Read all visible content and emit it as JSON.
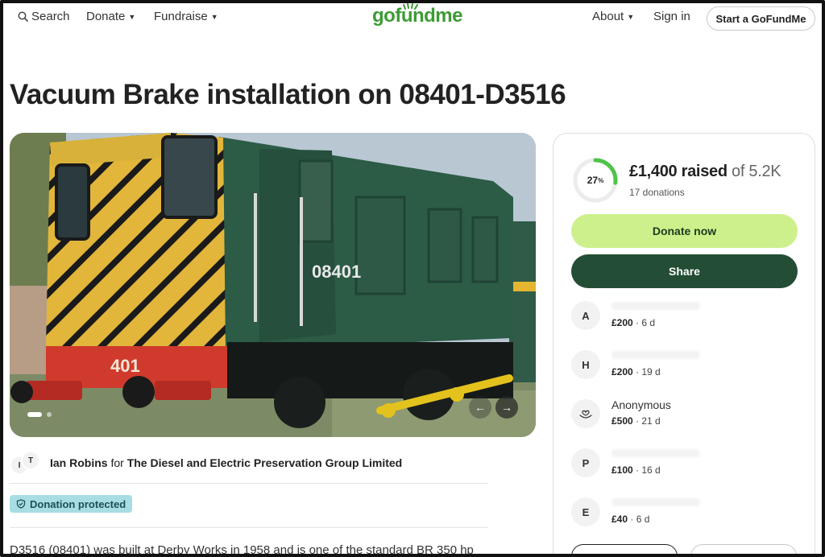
{
  "header": {
    "search_label": "Search",
    "donate_label": "Donate",
    "fundraise_label": "Fundraise",
    "logo_text": "gofundme",
    "about_label": "About",
    "signin_label": "Sign in",
    "start_label": "Start a GoFundMe"
  },
  "campaign": {
    "title": "Vacuum Brake installation on 08401-D3516",
    "hero_number_side": "08401",
    "hero_number_front": "401",
    "organizer_initials": [
      "I",
      "T"
    ],
    "organizer_name": "Ian Robins",
    "organizer_for": "for",
    "beneficiary": "The Diesel and Electric Preservation Group Limited",
    "protected_label": "Donation protected",
    "description_start": "D3516 (08401) was built at Derby Works in 1958 and is one of the standard BR 350 hp"
  },
  "sidebar": {
    "percent": "27",
    "percent_value": 0.27,
    "raised_amount": "£1,400 raised",
    "goal_text": "of 5.2K",
    "donation_count": "17 donations",
    "donate_now_label": "Donate now",
    "share_label": "Share",
    "donors": [
      {
        "initial": "A",
        "name": "",
        "amount": "£200",
        "age": "6 d"
      },
      {
        "initial": "H",
        "name": "",
        "amount": "£200",
        "age": "19 d"
      },
      {
        "initial": "",
        "name": "Anonymous",
        "amount": "£500",
        "age": "21 d"
      },
      {
        "initial": "P",
        "name": "",
        "amount": "£100",
        "age": "16 d"
      },
      {
        "initial": "E",
        "name": "",
        "amount": "£40",
        "age": "6 d"
      }
    ]
  },
  "colors": {
    "brand_green": "#3d9b35",
    "donate_button": "#cdf08c",
    "share_button": "#234d34",
    "protected_badge": "#a8dde4"
  },
  "icons": [
    "search-icon",
    "chevron-down-icon",
    "arrow-left-icon",
    "arrow-right-icon",
    "shield-icon",
    "heart-hand-icon"
  ]
}
